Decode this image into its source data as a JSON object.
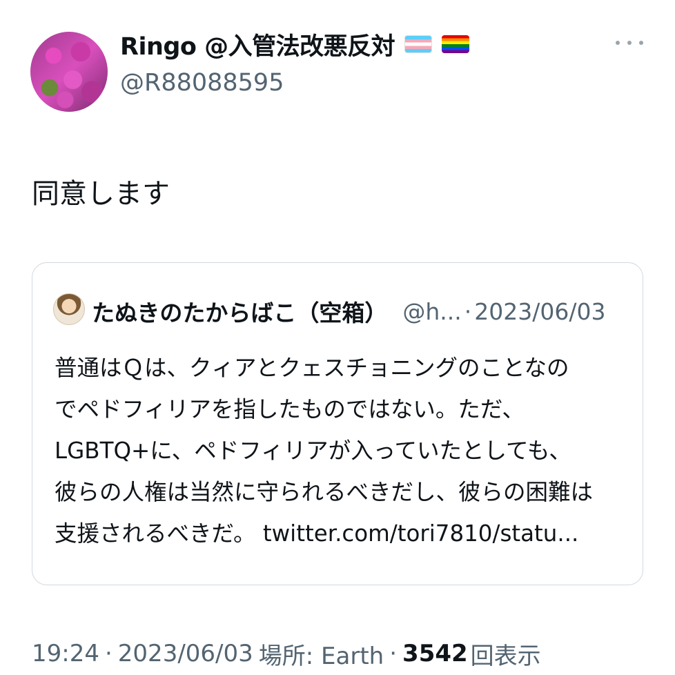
{
  "author": {
    "display_name": "Ringo @入管法改悪反対",
    "handle": "@R88088595",
    "flags": [
      "transgender-flag-icon",
      "rainbow-flag-icon"
    ]
  },
  "tweet": {
    "text": "同意します"
  },
  "quote": {
    "display_name": "たぬきのたからばこ（空箱）",
    "handle": "@h...",
    "separator": "·",
    "date": "2023/06/03",
    "lines": [
      "普通はＱは、クィアとクェスチョニングのことなの",
      "でペドフィリアを指したものではない。ただ、",
      "LGBTQ+に、ペドフィリアが入っていたとしても、",
      "彼らの人権は当然に守られるべきだし、彼らの困難は",
      "支援されるべきだ。 twitter.com/tori7810/statu..."
    ]
  },
  "meta": {
    "time": "19:24",
    "sep1": "·",
    "date": "2023/06/03",
    "location": "場所: Earth",
    "sep2": "·",
    "views_count": "3542",
    "views_label": "回表示"
  },
  "colors": {
    "text": "#0f1419",
    "secondary": "#536471",
    "border": "#cfd9de"
  }
}
